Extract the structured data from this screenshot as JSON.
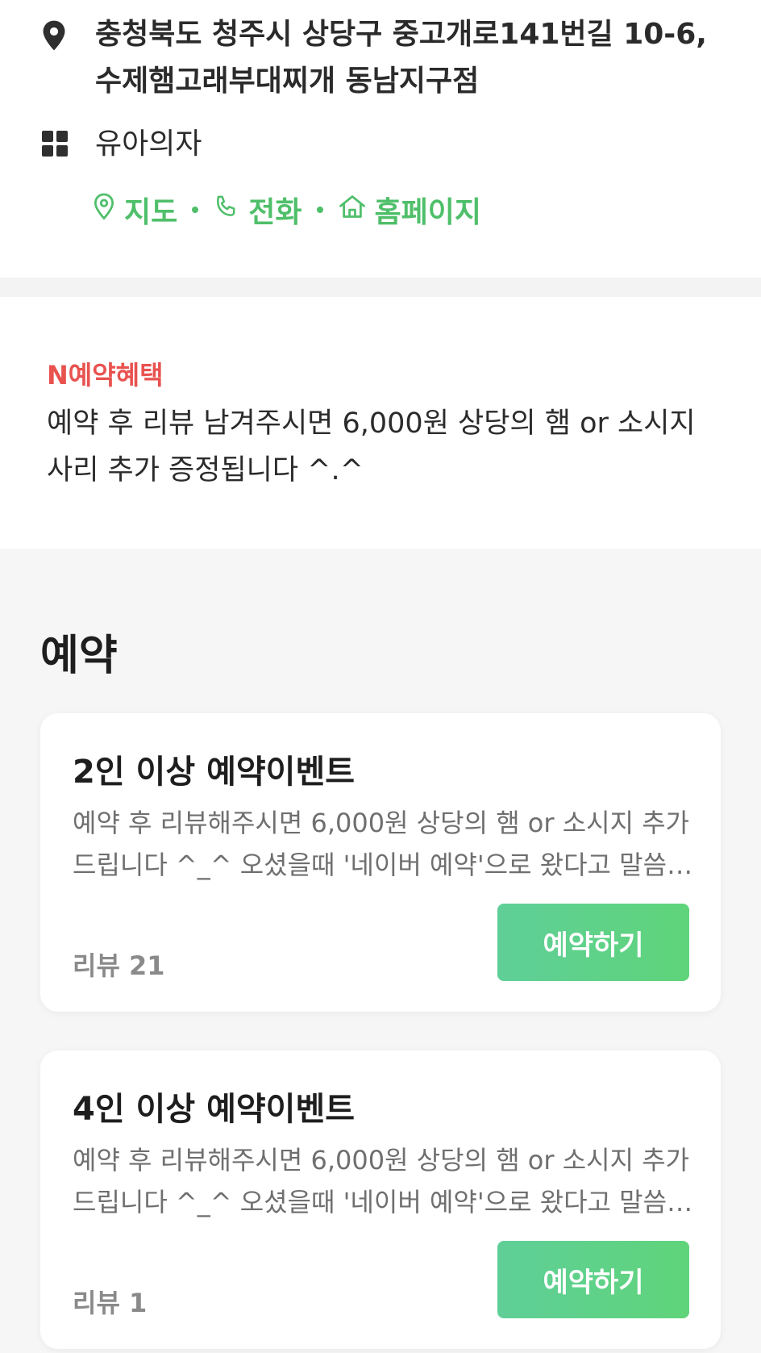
{
  "place": {
    "address": "충청북도 청주시 상당구 중고개로141번길 10-6, 수제햄고래부대찌개 동남지구점",
    "category": "유아의자",
    "links": [
      {
        "label": "지도",
        "icon": "map-pin-outline-icon"
      },
      {
        "label": "전화",
        "icon": "phone-icon"
      },
      {
        "label": "홈페이지",
        "icon": "home-icon"
      }
    ]
  },
  "benefit": {
    "title": "N예약혜택",
    "text": "예약 후 리뷰 남겨주시면 6,000원 상당의 햄 or 소시지 사리 추가 증정됩니다 ^.^"
  },
  "booking": {
    "section_title": "예약",
    "items": [
      {
        "title": "2인 이상 예약이벤트",
        "description": "예약 후 리뷰해주시면 6,000원 상당의 햄 or 소시지 추가 드립니다 ^_^ 오셨을때 '네이버 예약'으로 왔다고 말씀해주세요",
        "review": "리뷰 21",
        "button_label": "예약하기"
      },
      {
        "title": "4인 이상 예약이벤트",
        "description": "예약 후 리뷰해주시면 6,000원 상당의 햄 or 소시지 추가 드립니다 ^_^ 오셨을때 '네이버 예약'으로 왔다고 말씀해주세요",
        "review": "리뷰 1",
        "button_label": "예약하기"
      }
    ]
  },
  "colors": {
    "accent_green": "#4fbf6a",
    "benefit_red": "#e8524f",
    "button_green": "#5fd47a"
  }
}
